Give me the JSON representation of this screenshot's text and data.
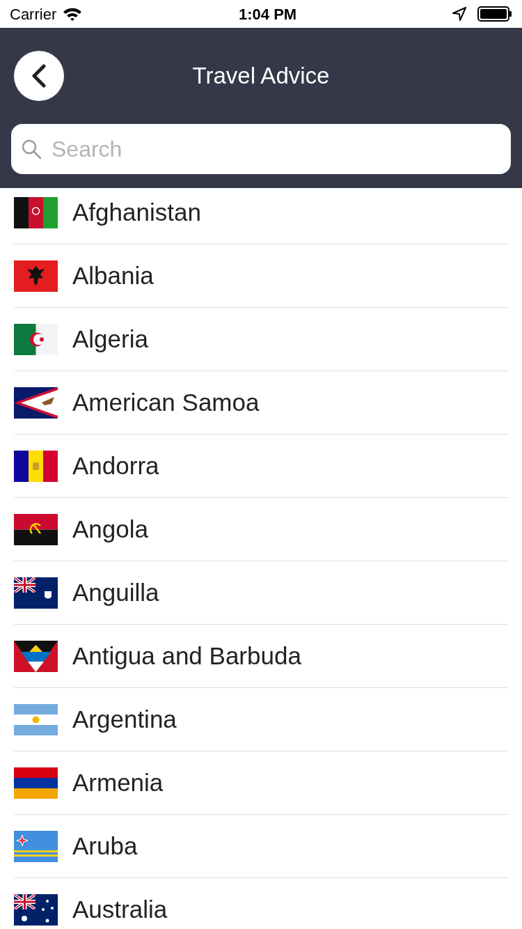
{
  "status_bar": {
    "carrier": "Carrier",
    "time": "1:04 PM"
  },
  "header": {
    "title": "Travel Advice"
  },
  "search": {
    "placeholder": "Search"
  },
  "countries": [
    {
      "name": "Afghanistan"
    },
    {
      "name": "Albania"
    },
    {
      "name": "Algeria"
    },
    {
      "name": "American Samoa"
    },
    {
      "name": "Andorra"
    },
    {
      "name": "Angola"
    },
    {
      "name": "Anguilla"
    },
    {
      "name": "Antigua and Barbuda"
    },
    {
      "name": "Argentina"
    },
    {
      "name": "Armenia"
    },
    {
      "name": "Aruba"
    },
    {
      "name": "Australia"
    }
  ]
}
